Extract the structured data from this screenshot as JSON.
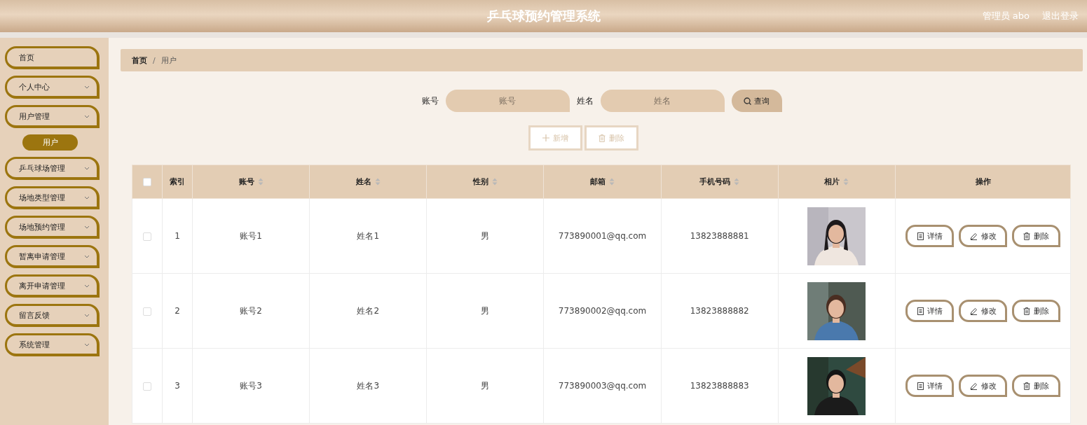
{
  "header": {
    "title": "乒乓球预约管理系统",
    "user": "管理员 abo",
    "logout": "退出登录"
  },
  "sidebar": {
    "items": [
      {
        "label": "首页",
        "kind": "link"
      },
      {
        "label": "个人中心",
        "kind": "submenu"
      },
      {
        "label": "用户管理",
        "kind": "submenu",
        "children": [
          {
            "label": "用户",
            "selected": true
          }
        ]
      },
      {
        "label": "乒乓球场管理",
        "kind": "submenu"
      },
      {
        "label": "场地类型管理",
        "kind": "submenu"
      },
      {
        "label": "场地预约管理",
        "kind": "submenu"
      },
      {
        "label": "暂离申请管理",
        "kind": "submenu"
      },
      {
        "label": "离开申请管理",
        "kind": "submenu"
      },
      {
        "label": "留言反馈",
        "kind": "submenu"
      },
      {
        "label": "系统管理",
        "kind": "submenu"
      }
    ]
  },
  "breadcrumb": {
    "items": [
      "首页",
      "用户"
    ],
    "separator": "/"
  },
  "search": {
    "fields": [
      {
        "label": "账号",
        "placeholder": "账号"
      },
      {
        "label": "姓名",
        "placeholder": "姓名"
      }
    ],
    "button": "查询"
  },
  "actions": [
    {
      "label": "新增",
      "kind": "add"
    },
    {
      "label": "删除",
      "kind": "delete"
    }
  ],
  "table": {
    "select_all": {
      "checked": false
    },
    "columns": [
      {
        "label": "索引",
        "sortable": false
      },
      {
        "label": "账号",
        "sortable": true
      },
      {
        "label": "姓名",
        "sortable": true
      },
      {
        "label": "性别",
        "sortable": true
      },
      {
        "label": "邮箱",
        "sortable": true
      },
      {
        "label": "手机号码",
        "sortable": true
      },
      {
        "label": "相片",
        "sortable": true
      },
      {
        "label": "操作",
        "sortable": false
      }
    ],
    "rows": [
      {
        "checked": false,
        "cells": [
          "1",
          "账号1",
          "姓名1",
          "男",
          "773890001@qq.com",
          "13823888881"
        ],
        "buttons": [
          {
            "label": "详情",
            "kind": "detail"
          },
          {
            "label": "修改",
            "kind": "edit"
          },
          {
            "label": "删除",
            "kind": "delete"
          }
        ]
      },
      {
        "checked": false,
        "cells": [
          "2",
          "账号2",
          "姓名2",
          "男",
          "773890002@qq.com",
          "13823888882"
        ],
        "buttons": [
          {
            "label": "详情",
            "kind": "detail"
          },
          {
            "label": "修改",
            "kind": "edit"
          },
          {
            "label": "删除",
            "kind": "delete"
          }
        ]
      },
      {
        "checked": false,
        "cells": [
          "3",
          "账号3",
          "姓名3",
          "男",
          "773890003@qq.com",
          "13823888883"
        ],
        "buttons": [
          {
            "label": "详情",
            "kind": "detail"
          },
          {
            "label": "修改",
            "kind": "edit"
          },
          {
            "label": "删除",
            "kind": "delete"
          }
        ]
      }
    ]
  }
}
